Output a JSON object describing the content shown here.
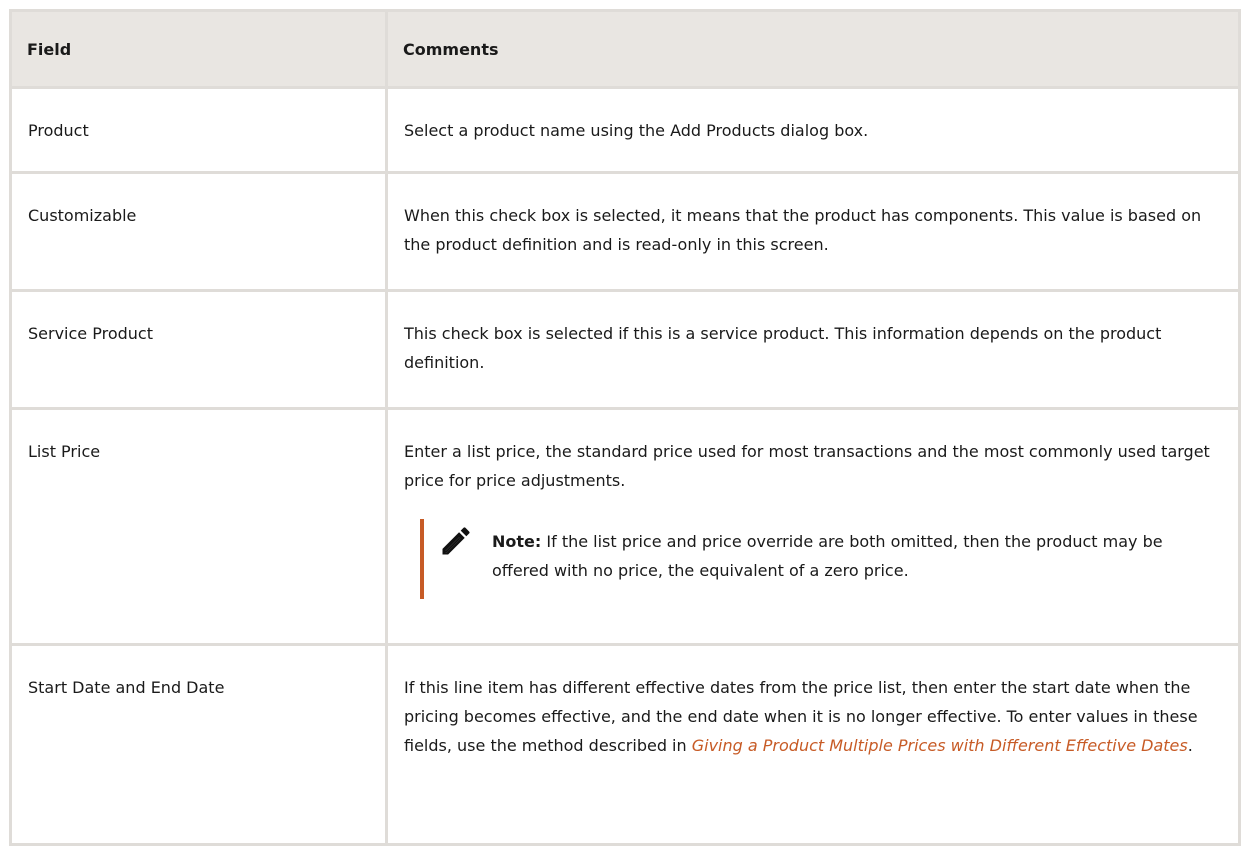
{
  "table": {
    "headers": {
      "field": "Field",
      "comments": "Comments"
    },
    "rows": [
      {
        "field": "Product",
        "comment": "Select a product name using the Add Products dialog box."
      },
      {
        "field": "Customizable",
        "comment": "When this check box is selected, it means that the product has components. This value is based on the product definition and is read-only in this screen."
      },
      {
        "field": "Service Product",
        "comment": "This check box is selected if this is a service product. This information depends on the product definition."
      },
      {
        "field": "List Price",
        "comment": "Enter a list price, the standard price used for most transactions and the most commonly used target price for price adjustments.",
        "note": {
          "icon": "pencil-icon",
          "label": "Note:",
          "text": "If the list price and price override are both omitted, then the product may be offered with no price, the equivalent of a zero price."
        }
      },
      {
        "field": "Start Date and End Date",
        "comment_before_link": "If this line item has different effective dates from the price list, then enter the start date when the pricing becomes effective, and the end date when it is no longer effective. To enter values in these fields, use the method described in ",
        "link_text": "Giving a Product Multiple Prices with Different Effective Dates",
        "comment_after_link": "."
      }
    ]
  },
  "colors": {
    "border": "#dfdcd8",
    "header_bg": "#e9e6e2",
    "accent": "#c75b26"
  }
}
